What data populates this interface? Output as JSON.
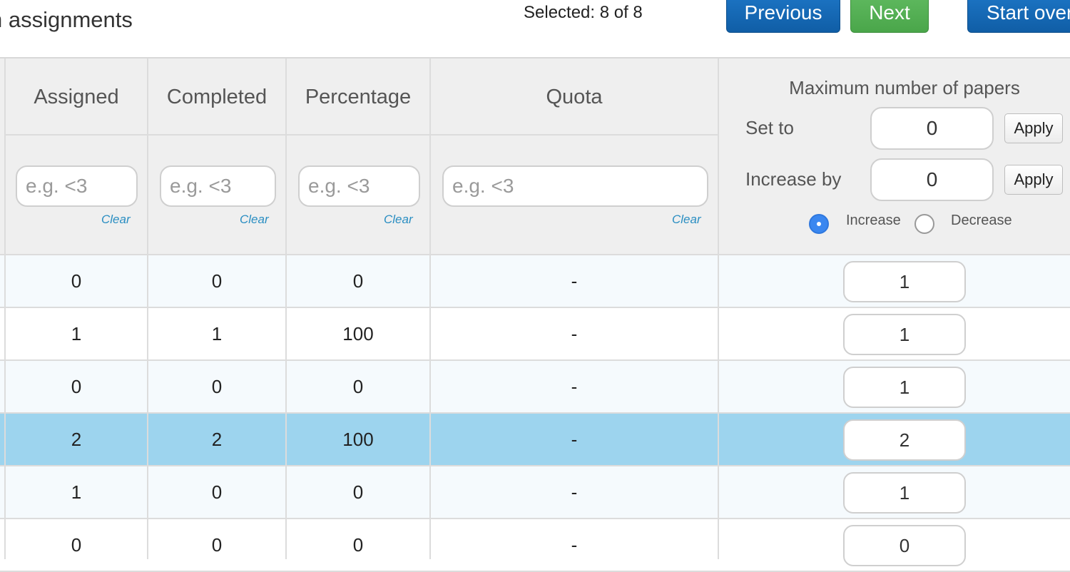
{
  "header": {
    "title": "n assignments",
    "selected": "Selected: 8 of 8",
    "prev_label": "Previous",
    "next_label": "Next",
    "start_label": "Start over"
  },
  "columns": {
    "assigned": "Assigned",
    "completed": "Completed",
    "percentage": "Percentage",
    "quota": "Quota"
  },
  "filters": {
    "placeholder": "e.g. <3",
    "clear_label": "Clear"
  },
  "max_papers": {
    "title": "Maximum number of papers",
    "set_to_label": "Set to",
    "set_to_value": "0",
    "increase_by_label": "Increase by",
    "increase_by_value": "0",
    "apply_label": "Apply",
    "increase_label": "Increase",
    "decrease_label": "Decrease",
    "selected_mode": "Increase"
  },
  "rows": [
    {
      "assigned": "0",
      "completed": "0",
      "percentage": "0",
      "quota": "-",
      "max": "1"
    },
    {
      "assigned": "1",
      "completed": "1",
      "percentage": "100",
      "quota": "-",
      "max": "1"
    },
    {
      "assigned": "0",
      "completed": "0",
      "percentage": "0",
      "quota": "-",
      "max": "1"
    },
    {
      "assigned": "2",
      "completed": "2",
      "percentage": "100",
      "quota": "-",
      "max": "2"
    },
    {
      "assigned": "1",
      "completed": "0",
      "percentage": "0",
      "quota": "-",
      "max": "1"
    },
    {
      "assigned": "0",
      "completed": "0",
      "percentage": "0",
      "quota": "-",
      "max": "0"
    }
  ],
  "colors": {
    "primary_button": "#105ea6",
    "success_button": "#4aa64a",
    "selected_row": "#9dd4ee",
    "link": "#2a8ec2",
    "radio_on": "#3a87f0"
  }
}
